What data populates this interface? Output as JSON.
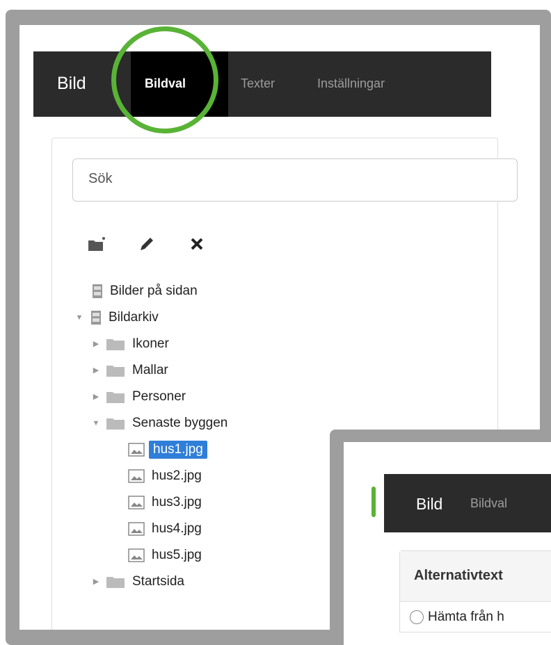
{
  "navbar": {
    "brand": "Bild",
    "tabs": [
      {
        "label": "Bildval",
        "active": true
      },
      {
        "label": "Texter",
        "active": false
      },
      {
        "label": "Inställningar",
        "active": false
      }
    ]
  },
  "search": {
    "placeholder": "Sök",
    "value": ""
  },
  "toolbar": {
    "icons": [
      "new-folder-icon",
      "pencil-icon",
      "close-icon"
    ]
  },
  "tree": {
    "items": [
      {
        "label": "Bilder på sidan",
        "icon": "archive-icon",
        "expanded": null
      },
      {
        "label": "Bildarkiv",
        "icon": "archive-icon",
        "expanded": true
      },
      {
        "label": "Ikoner",
        "icon": "folder-icon",
        "expanded": false
      },
      {
        "label": "Mallar",
        "icon": "folder-icon",
        "expanded": false
      },
      {
        "label": "Personer",
        "icon": "folder-icon",
        "expanded": false
      },
      {
        "label": "Senaste byggen",
        "icon": "folder-icon",
        "expanded": true
      },
      {
        "label": "hus1.jpg",
        "icon": "image-icon",
        "selected": true
      },
      {
        "label": "hus2.jpg",
        "icon": "image-icon"
      },
      {
        "label": "hus3.jpg",
        "icon": "image-icon"
      },
      {
        "label": "hus4.jpg",
        "icon": "image-icon"
      },
      {
        "label": "hus5.jpg",
        "icon": "image-icon"
      },
      {
        "label": "Startsida",
        "icon": "folder-icon",
        "expanded": false
      }
    ]
  },
  "overlay": {
    "brand": "Bild",
    "tab": "Bildval",
    "panel_title": "Alternativtext",
    "radio_label": "Hämta från h"
  },
  "colors": {
    "highlight": "#59b336",
    "navbar": "#2b2b2b",
    "selected": "#2f7ed8"
  }
}
